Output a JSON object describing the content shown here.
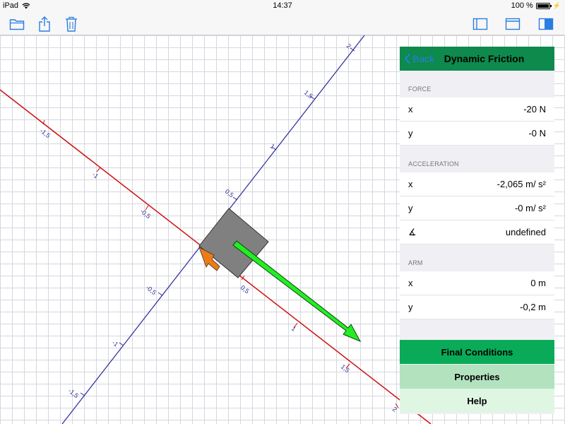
{
  "status": {
    "device": "iPad",
    "time": "14:37",
    "battery": "100 %",
    "battery_level": 1.0
  },
  "toolbar": {
    "icons": [
      "folder-icon",
      "share-icon",
      "trash-icon",
      "sidebar-left-icon",
      "window-icon",
      "sidebar-right-icon"
    ]
  },
  "axes": {
    "red_labels": [
      "-1,5",
      "-1",
      "-0,5",
      "0,5",
      "1",
      "1,5",
      "2"
    ],
    "blue_labels": [
      "2",
      "1,5",
      "1",
      "0,5",
      "-0,5",
      "-1",
      "-1,5"
    ]
  },
  "colors": {
    "accent_green": "#0d8a4c",
    "button_green": "#0aab58",
    "force_arrow": "#22ee22",
    "friction_arrow": "#f07b14",
    "x_axis": "#cc1111",
    "y_axis": "#2a2a9a"
  },
  "panel": {
    "back_label": "Back",
    "title": "Dynamic Friction",
    "sections": [
      {
        "header": "FORCE",
        "rows": [
          {
            "label": "x",
            "value": "-20 N"
          },
          {
            "label": "y",
            "value": "-0 N"
          }
        ]
      },
      {
        "header": "ACCELERATION",
        "rows": [
          {
            "label": "x",
            "value": "-2,065 m/ s²"
          },
          {
            "label": "y",
            "value": "-0 m/ s²"
          },
          {
            "label": "∡",
            "value": "undefined"
          }
        ]
      },
      {
        "header": "ARM",
        "rows": [
          {
            "label": "x",
            "value": "0 m"
          },
          {
            "label": "y",
            "value": "-0,2 m"
          }
        ]
      }
    ],
    "buttons": {
      "final_conditions": "Final Conditions",
      "properties": "Properties",
      "help": "Help"
    }
  }
}
